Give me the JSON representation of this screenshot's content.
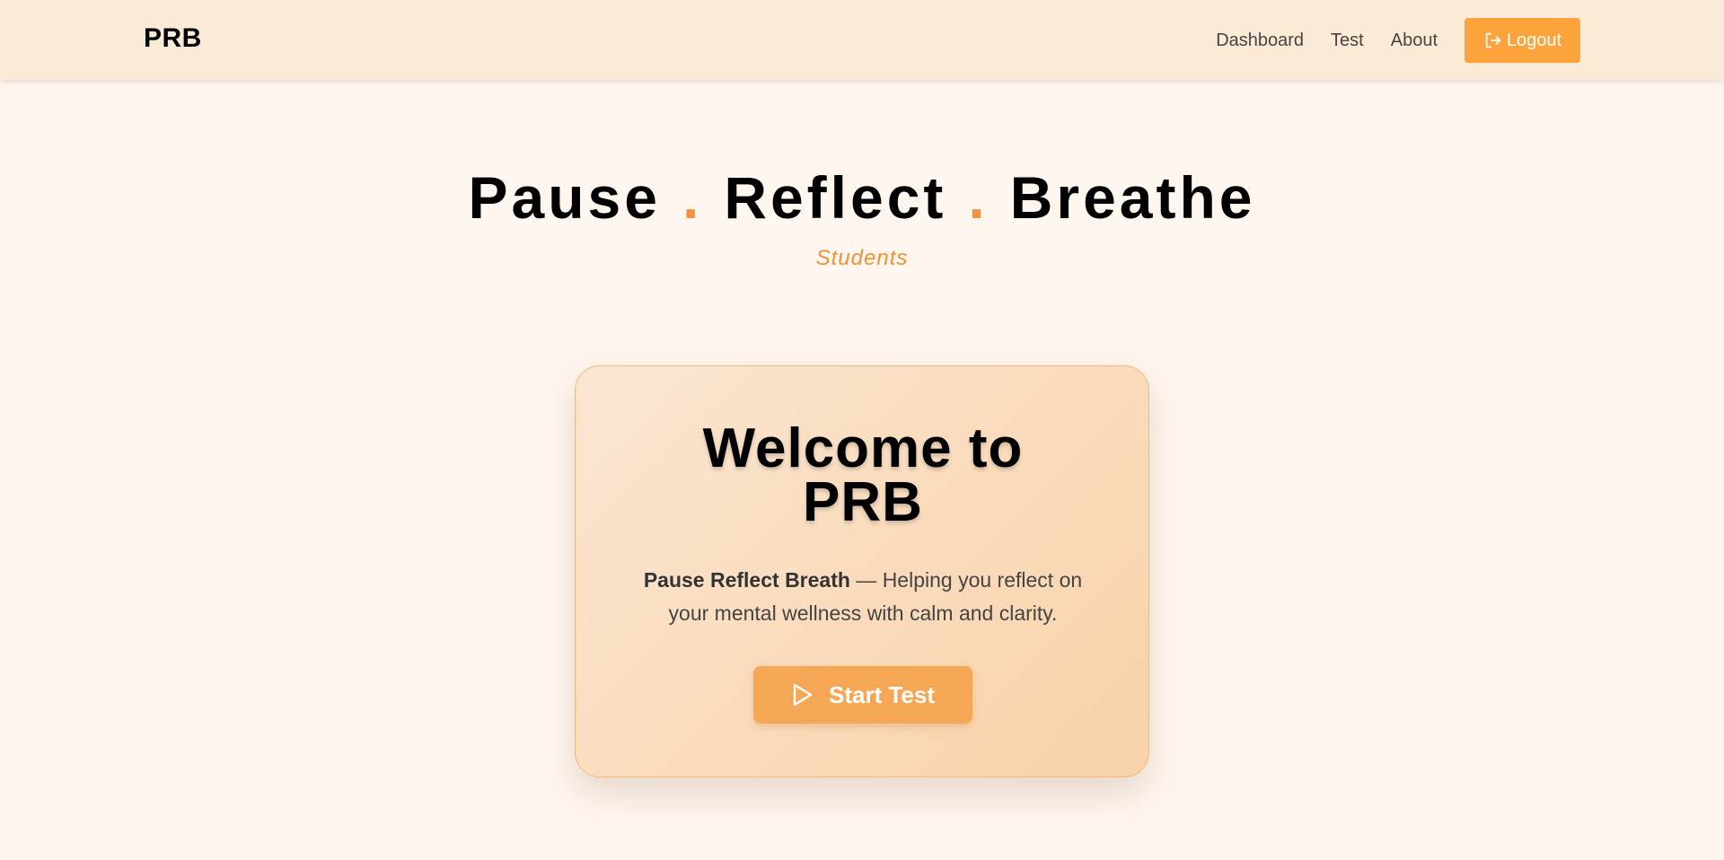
{
  "nav": {
    "brand": "PRB",
    "links": [
      "Dashboard",
      "Test",
      "About"
    ],
    "logout_label": "Logout",
    "logout_icon": "logout-icon"
  },
  "hero": {
    "word1": "Pause",
    "word2": "Reflect",
    "word3": "Breathe",
    "separator": ".",
    "subtitle": "Students"
  },
  "card": {
    "title_line1": "Welcome to",
    "title_line2": "PRB",
    "desc_bold": "Pause Reflect Breath",
    "desc_rest": " — Helping you reflect on your mental wellness with calm and clarity.",
    "start_label": "Start Test",
    "start_icon": "play-icon"
  },
  "colors": {
    "accent": "#fca33b",
    "accent_text": "#f0922f",
    "navbar_bg": "#fbead6",
    "page_bg": "#fff6ef"
  }
}
